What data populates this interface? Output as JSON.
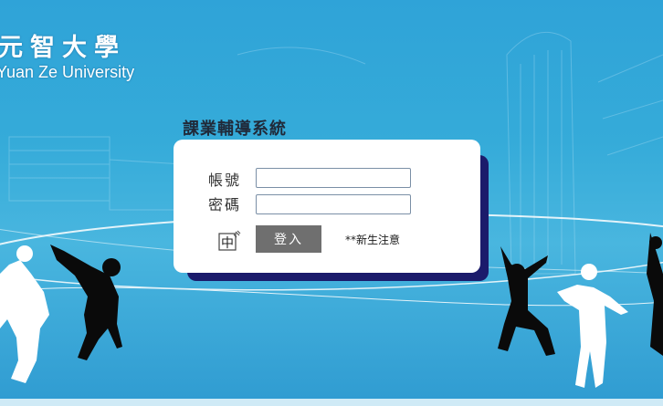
{
  "logo": {
    "chinese": "元智大學",
    "english": "Yuan Ze University"
  },
  "system_title": "課業輔導系統",
  "login": {
    "account_label": "帳號",
    "password_label": "密碼",
    "account_value": "",
    "password_value": "",
    "login_button": "登入",
    "new_student_notice": "**新生注意",
    "ime_icon": "chinese-input-icon"
  },
  "colors": {
    "background": "#35abd9",
    "card_shadow": "#1b1b6b",
    "button": "#6f6f6f",
    "title_text": "#202a3a"
  }
}
